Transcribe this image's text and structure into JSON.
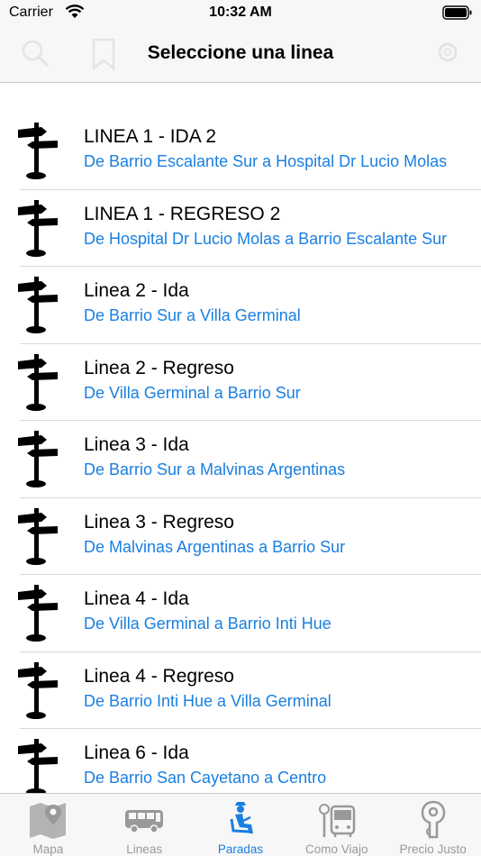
{
  "status_bar": {
    "carrier": "Carrier",
    "time": "10:32 AM"
  },
  "nav": {
    "title": "Seleccione una linea",
    "left_icons": [
      "search-icon",
      "bookmark-icon"
    ],
    "right_icon": "settings-icon"
  },
  "rows": [
    {
      "title": "LINEA 1 - IDA 2",
      "subtitle": "De Barrio Escalante Sur a  Hospital Dr Lucio Molas"
    },
    {
      "title": "LINEA 1 - REGRESO 2",
      "subtitle": "De Hospital Dr Lucio Molas a Barrio Escalante Sur"
    },
    {
      "title": "Linea 2 - Ida",
      "subtitle": "De Barrio Sur a Villa Germinal"
    },
    {
      "title": "Linea 2 - Regreso",
      "subtitle": "De Villa Germinal a Barrio Sur"
    },
    {
      "title": "Linea 3 - Ida",
      "subtitle": "De Barrio Sur a Malvinas Argentinas"
    },
    {
      "title": "Linea 3 - Regreso",
      "subtitle": "De Malvinas Argentinas a Barrio Sur"
    },
    {
      "title": "Linea 4 - Ida",
      "subtitle": "De Villa Germinal a Barrio Inti Hue"
    },
    {
      "title": "Linea 4 - Regreso",
      "subtitle": "De Barrio Inti Hue  a Villa Germinal"
    },
    {
      "title": "Linea 6 - Ida",
      "subtitle": "De Barrio San Cayetano a Centro"
    }
  ],
  "tabs": [
    {
      "label": "Mapa",
      "icon": "map-icon",
      "active": false
    },
    {
      "label": "Lineas",
      "icon": "bus-icon",
      "active": false
    },
    {
      "label": "Paradas",
      "icon": "bus-stop-seat-icon",
      "active": true
    },
    {
      "label": "Como Viajo",
      "icon": "bus-stop-icon",
      "active": false
    },
    {
      "label": "Precio Justo",
      "icon": "price-tag-icon",
      "active": false
    }
  ],
  "colors": {
    "accent": "#1a7fe0",
    "inactive": "#999999",
    "bar_background": "#f7f7f7"
  }
}
